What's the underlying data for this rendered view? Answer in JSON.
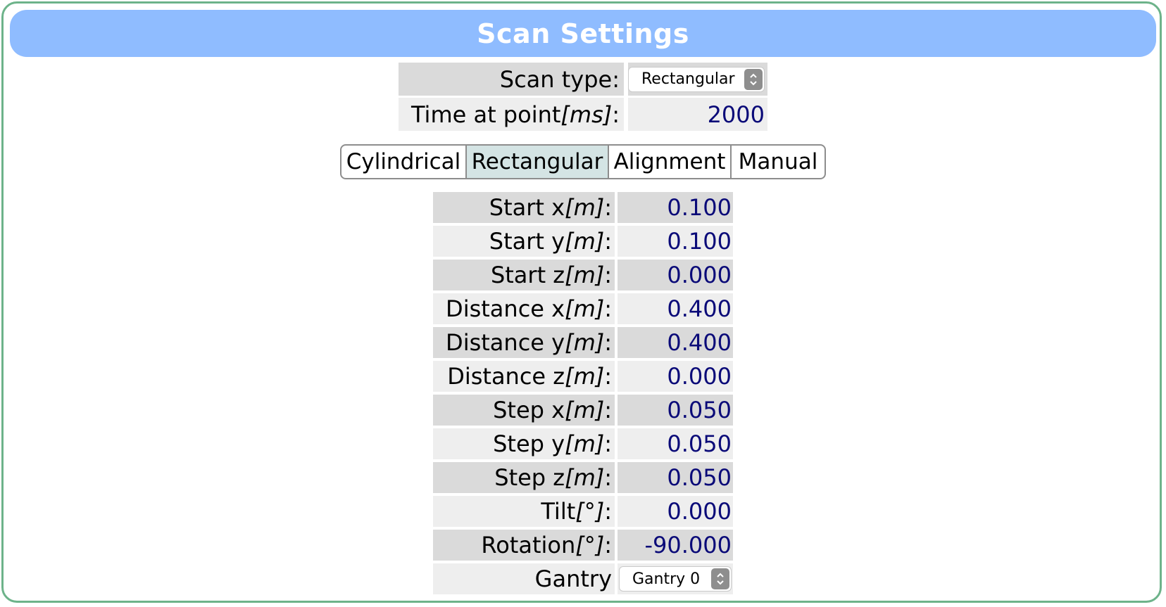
{
  "title": "Scan Settings",
  "scan_type": {
    "label": "Scan type:",
    "selected": "Rectangular"
  },
  "time_at_point": {
    "label": "Time at point ",
    "unit": "[ms]",
    "suffix": ":",
    "value": "2000"
  },
  "tabs": [
    {
      "label": "Cylindrical",
      "active": false
    },
    {
      "label": "Rectangular",
      "active": true
    },
    {
      "label": "Alignment",
      "active": false
    },
    {
      "label": "Manual",
      "active": false
    }
  ],
  "params": [
    {
      "label": "Start x ",
      "unit": "[m]",
      "value": "0.100"
    },
    {
      "label": "Start y ",
      "unit": "[m]",
      "value": "0.100"
    },
    {
      "label": "Start z ",
      "unit": "[m]",
      "value": "0.000"
    },
    {
      "label": "Distance x ",
      "unit": "[m]",
      "value": "0.400"
    },
    {
      "label": "Distance y ",
      "unit": "[m]",
      "value": "0.400"
    },
    {
      "label": "Distance z ",
      "unit": "[m]",
      "value": "0.000"
    },
    {
      "label": "Step x ",
      "unit": "[m]",
      "value": "0.050"
    },
    {
      "label": "Step y ",
      "unit": "[m]",
      "value": "0.050"
    },
    {
      "label": "Step z ",
      "unit": "[m]",
      "value": "0.050"
    },
    {
      "label": "Tilt ",
      "unit": "[°]",
      "value": "0.000"
    },
    {
      "label": "Rotation ",
      "unit": "[°]",
      "value": "-90.000"
    }
  ],
  "params_suffix": ":",
  "gantry": {
    "label": "Gantry",
    "selected": "Gantry 0"
  },
  "colors": {
    "frame_border": "#6db38a",
    "title_bar": "#8fbcff",
    "value_text": "#0a0a78",
    "row_dark": "#dadada",
    "row_light": "#eeeeee",
    "tab_active": "#d4e4e4"
  },
  "icons": {
    "select_arrows": "chevron-up-down-icon"
  }
}
